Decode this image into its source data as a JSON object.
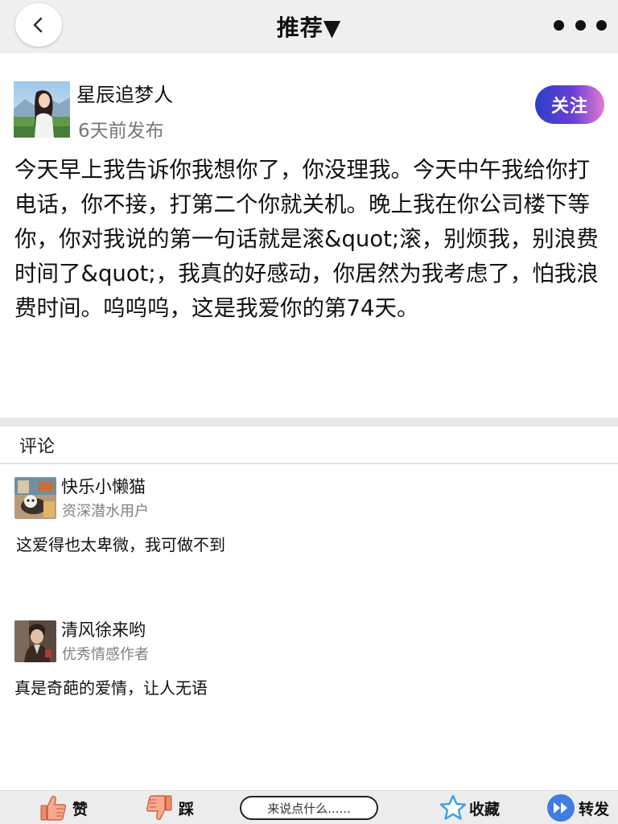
{
  "nav": {
    "title": "推荐▼"
  },
  "post": {
    "author": "星辰追梦人",
    "time": "6天前发布",
    "follow_label": "关注",
    "content": "今天早上我告诉你我想你了，你没理我。今天中午我给你打电话，你不接，打第二个你就关机。晚上我在你公司楼下等你，你对我说的第一句话就是滚&quot;滚，别烦我，别浪费时间了&quot;，我真的好感动，你居然为我考虑了，怕我浪费时间。呜呜呜，这是我爱你的第74天。"
  },
  "comments_section": {
    "title": "评论",
    "items": [
      {
        "name": "快乐小懒猫",
        "badge": "资深潜水用户",
        "text": "这爱得也太卑微，我可做不到"
      },
      {
        "name": "清风徐来哟",
        "badge": "优秀情感作者",
        "text": "真是奇葩的爱情，让人无语"
      }
    ]
  },
  "bottombar": {
    "like_label": "赞",
    "dislike_label": "踩",
    "input_placeholder": "来说点什么......",
    "favorite_label": "收藏",
    "share_label": "转发"
  },
  "colors": {
    "follow_gradient_start": "#2a3fc9",
    "follow_gradient_end": "#e37bd0",
    "like_icon": "#f08a6b",
    "star_icon": "#3aa0ea",
    "share_icon": "#3f7de0"
  },
  "icons": {
    "back": "chevron-left-icon",
    "more": "more-dots-icon",
    "like": "thumbs-up-icon",
    "dislike": "thumbs-down-icon",
    "favorite": "star-icon",
    "share": "forward-icon"
  }
}
